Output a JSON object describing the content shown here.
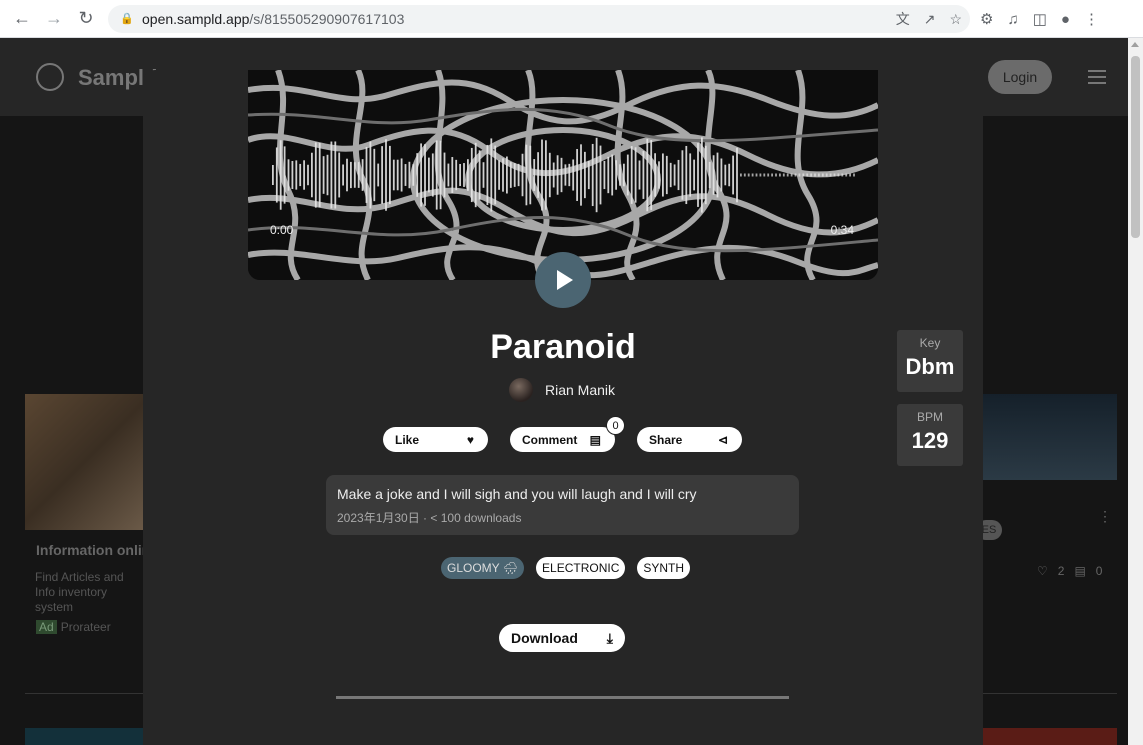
{
  "browser": {
    "url_host": "open.sampld.app",
    "url_path": "/s/815505290907617103",
    "icons": [
      "back-icon",
      "forward-icon",
      "reload-icon",
      "lock-icon",
      "translate-icon",
      "share-icon",
      "star-icon",
      "extensions-icon",
      "media-icon",
      "sidepanel-icon",
      "profile-icon",
      "more-icon"
    ]
  },
  "site": {
    "logo_text": "Sampld",
    "login_label": "Login",
    "bg_card": {
      "title": "Information onlin",
      "desc": "Find Articles and Info inventory system",
      "ad_badge": "Ad",
      "ad_source": "Prorateer"
    },
    "bg_right": {
      "tag": "ES",
      "likes": "2",
      "comments": "0"
    }
  },
  "player": {
    "time_start": "0:00",
    "time_end": "0:34"
  },
  "sample": {
    "title": "Paranoid",
    "artist": "Rian Manik",
    "key_label": "Key",
    "key_value": "Dbm",
    "bpm_label": "BPM",
    "bpm_value": "129",
    "like_label": "Like",
    "comment_label": "Comment",
    "comment_count": "0",
    "share_label": "Share",
    "description": "Make a joke and I will sigh and you will laugh and I will cry",
    "meta": "2023年1月30日 · < 100 downloads",
    "tags": [
      {
        "label": "GLOOMY 🌧",
        "active": true
      },
      {
        "label": "ELECTRONIC",
        "active": false
      },
      {
        "label": "SYNTH",
        "active": false
      }
    ],
    "download_label": "Download"
  },
  "colors": {
    "accent": "#4b6572",
    "modal_bg": "#262626",
    "panel_bg": "#3a3a3a"
  }
}
